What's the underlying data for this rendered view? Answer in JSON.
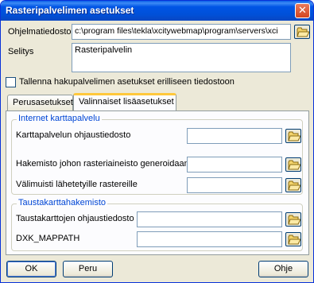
{
  "window": {
    "title": "Rasteripalvelimen asetukset",
    "close_label": "✕"
  },
  "program_file": {
    "label": "Ohjelmatiedosto",
    "value": "c:\\program files\\tekla\\xcitywebmap\\program\\servers\\xci"
  },
  "description": {
    "label": "Selitys",
    "value": "Rasteripalvelin"
  },
  "save_separately": {
    "label": "Tallenna hakupalvelimen asetukset erilliseen tiedostoon",
    "checked": false
  },
  "tabs": [
    {
      "label": "Perusasetukset",
      "active": false
    },
    {
      "label": "Valinnaiset lisäasetukset",
      "active": true
    }
  ],
  "internet_group": {
    "title": "Internet karttapalvelu",
    "fields": [
      {
        "label": "Karttapalvelun ohjaustiedosto",
        "value": ""
      },
      {
        "label": "Hakemisto johon rasteriaineisto generoidaan",
        "value": ""
      },
      {
        "label": "Välimuisti lähetetyille rastereille",
        "value": ""
      }
    ]
  },
  "background_group": {
    "title": "Taustakarttahakemisto",
    "fields": [
      {
        "label": "Taustakarttojen ohjaustiedosto",
        "value": ""
      },
      {
        "label": "DXK_MAPPATH",
        "value": ""
      }
    ]
  },
  "buttons": {
    "ok": "OK",
    "cancel": "Peru",
    "help": "Ohje"
  },
  "icons": {
    "browse": "open-folder-icon"
  },
  "colors": {
    "title_bar": "#0055e5",
    "group_title": "#0046d5",
    "dialog_bg": "#ece9d8"
  }
}
